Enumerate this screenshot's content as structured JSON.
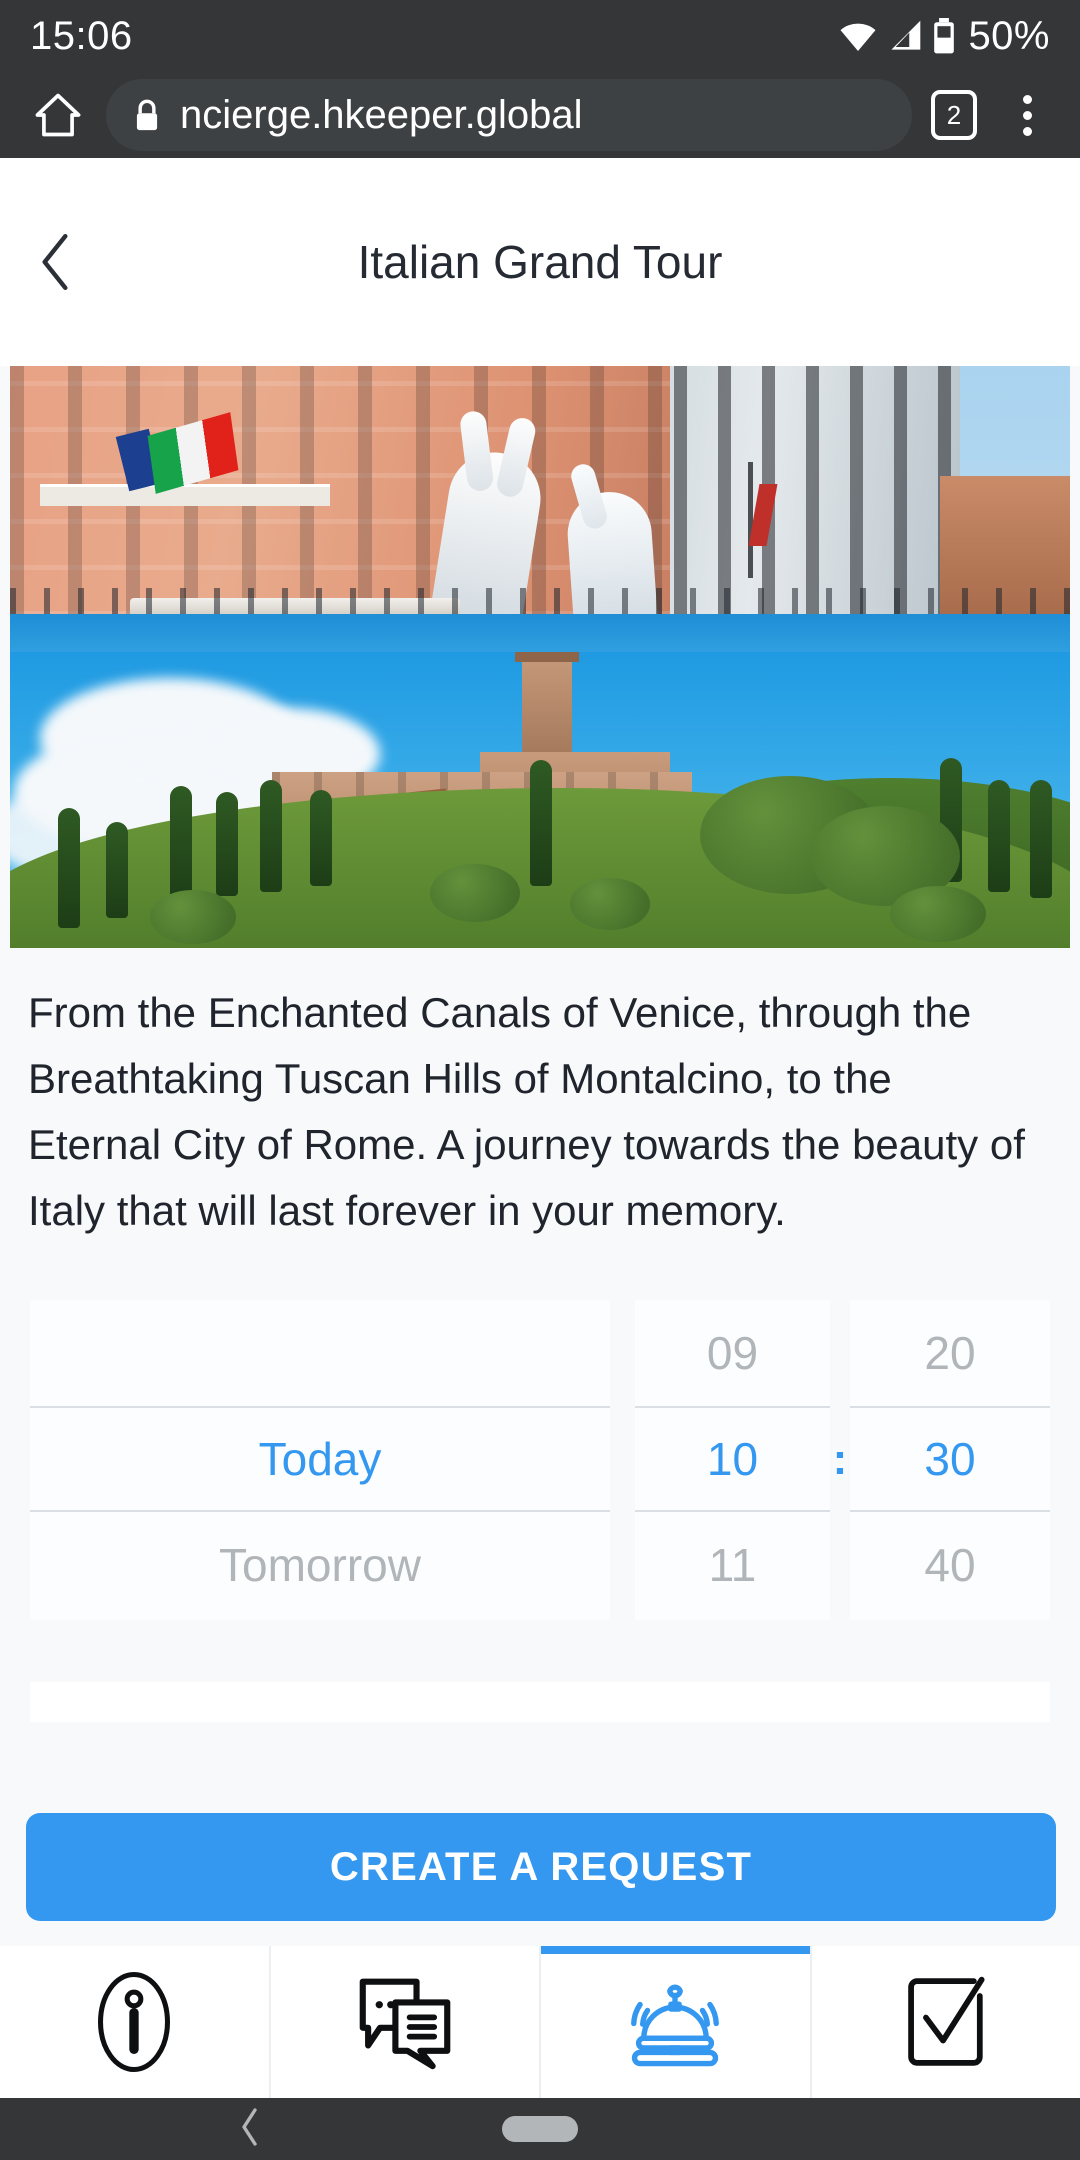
{
  "status_bar": {
    "time": "15:06",
    "battery_percent": "50%",
    "icons": [
      "wifi-icon",
      "cellular-signal-icon",
      "battery-icon"
    ]
  },
  "browser": {
    "home_icon": "home-icon",
    "lock_icon": "lock-icon",
    "url": "ncierge.hkeeper.global",
    "tab_count": "2",
    "menu_icon": "overflow-menu-icon"
  },
  "header": {
    "back_icon": "chevron-left-icon",
    "title": "Italian Grand Tour"
  },
  "gallery": {
    "images": [
      {
        "name": "venice-grand-canal-photo",
        "alt": "Venice Grand Canal palazzo with Italian flag and white hand sculptures"
      },
      {
        "name": "tuscany-hilltop-village-photo",
        "alt": "Tuscan hilltop village with cypress trees under blue sky"
      }
    ]
  },
  "description": "From the Enchanted Canals of Venice, through the Breathtaking Tuscan Hills of Montalcino, to the Eternal City of Rome. A journey towards the beauty of Italy that will last forever in your memory.",
  "picker": {
    "date": {
      "above": "",
      "selected": "Today",
      "below": "Tomorrow"
    },
    "hour": {
      "above": "09",
      "selected": "10",
      "below": "11"
    },
    "separator": ":",
    "minute": {
      "above": "20",
      "selected": "30",
      "below": "40"
    },
    "accent_color": "#3498f0",
    "inactive_color": "#b0b5ba"
  },
  "cta": {
    "label": "CREATE A REQUEST",
    "color": "#3498f0"
  },
  "tabbar": {
    "active_color": "#3498f0",
    "items": [
      {
        "name": "tab-info",
        "icon": "info-circle-icon",
        "active": false
      },
      {
        "name": "tab-chat",
        "icon": "chat-bubbles-icon",
        "active": false
      },
      {
        "name": "tab-concierge",
        "icon": "service-bell-icon",
        "active": true
      },
      {
        "name": "tab-tasks",
        "icon": "checkbox-check-icon",
        "active": false
      }
    ]
  },
  "android_nav": {
    "back_icon": "nav-back-icon",
    "home_icon": "nav-home-pill-icon"
  }
}
